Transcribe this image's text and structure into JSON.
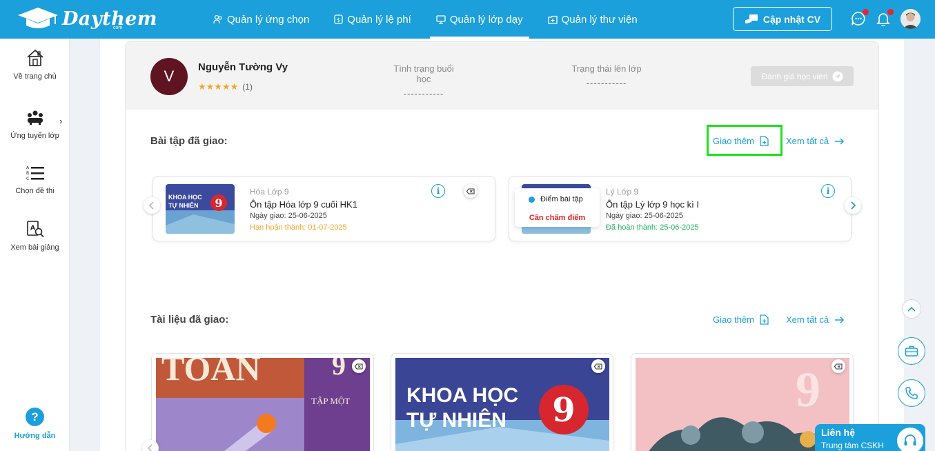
{
  "brand": {
    "name": "Daythem",
    "suffix": "com"
  },
  "nav": [
    {
      "label": "Quản lý ứng chọn",
      "icon": "users-icon"
    },
    {
      "label": "Quản lý lệ phí",
      "icon": "fee-icon"
    },
    {
      "label": "Quản lý lớp dạy",
      "icon": "classroom-icon",
      "active": true
    },
    {
      "label": "Quản lý thư viện",
      "icon": "library-icon"
    }
  ],
  "header": {
    "update_cv": "Cập nhật CV"
  },
  "sidebar": {
    "items": [
      {
        "label": "Về trang chủ",
        "icon": "home-icon"
      },
      {
        "label": "Ứng tuyển lớp",
        "icon": "group-icon"
      },
      {
        "label": "Chọn đề thi",
        "icon": "list-abc-icon"
      },
      {
        "label": "Xem bài giảng",
        "icon": "lecture-search-icon"
      }
    ],
    "help": {
      "label": "Hướng dẫn",
      "glyph": "?"
    }
  },
  "student": {
    "initial": "V",
    "name": "Nguyễn Tường Vy",
    "stars": "★★★★★",
    "rating_count": "(1)",
    "session_status_label": "Tình trạng buổi học",
    "session_status_value": "-----------",
    "attendance_label": "Trạng thái lên lớp",
    "attendance_value": "-----------",
    "rate_button": "Đánh giá học viên"
  },
  "homework": {
    "title": "Bài tập đã giao:",
    "add_more": "Giao thêm",
    "view_all": "Xem tất cả",
    "items": [
      {
        "subject": "Hóa Lớp 9",
        "title": "Ôn tập Hóa lớp 9 cuối HK1",
        "assigned": "Ngày giao: 25-06-2025",
        "deadline": "Hạn hoàn thành: 01-07-2025",
        "deadline_color": "#f5a623",
        "thumb_text": [
          "KHOA HỌC",
          "TỰ NHIÊN"
        ],
        "thumb_number": "9"
      },
      {
        "subject": "Lý Lớp 9",
        "title": "Ôn tập Lý lớp 9 học kì I",
        "assigned": "Ngày giao: 25-06-2025",
        "deadline": "Đã hoàn thành: 25-06-2025",
        "deadline_color": "#1fb35a",
        "popup_line1": "Điểm bài tập",
        "popup_line2": "Cần chấm điểm"
      }
    ]
  },
  "documents": {
    "title": "Tài liệu đã giao:",
    "add_more": "Giao thêm",
    "view_all": "Xem tất cả",
    "items": [
      {
        "cover_text": "TOÁN",
        "cover_sub": "TẬP MỘT",
        "cover_number": "9"
      },
      {
        "cover_text_1": "KHOA HỌC",
        "cover_text_2": "TỰ NHIÊN",
        "cover_number": "9"
      },
      {
        "cover_number": "9"
      }
    ]
  },
  "contact": {
    "title": "Liên hệ",
    "subtitle": "Trung tâm CSKH"
  },
  "colors": {
    "primary": "#1ba0db",
    "highlight": "#1ee21e",
    "avatar_bg": "#5f1422"
  }
}
